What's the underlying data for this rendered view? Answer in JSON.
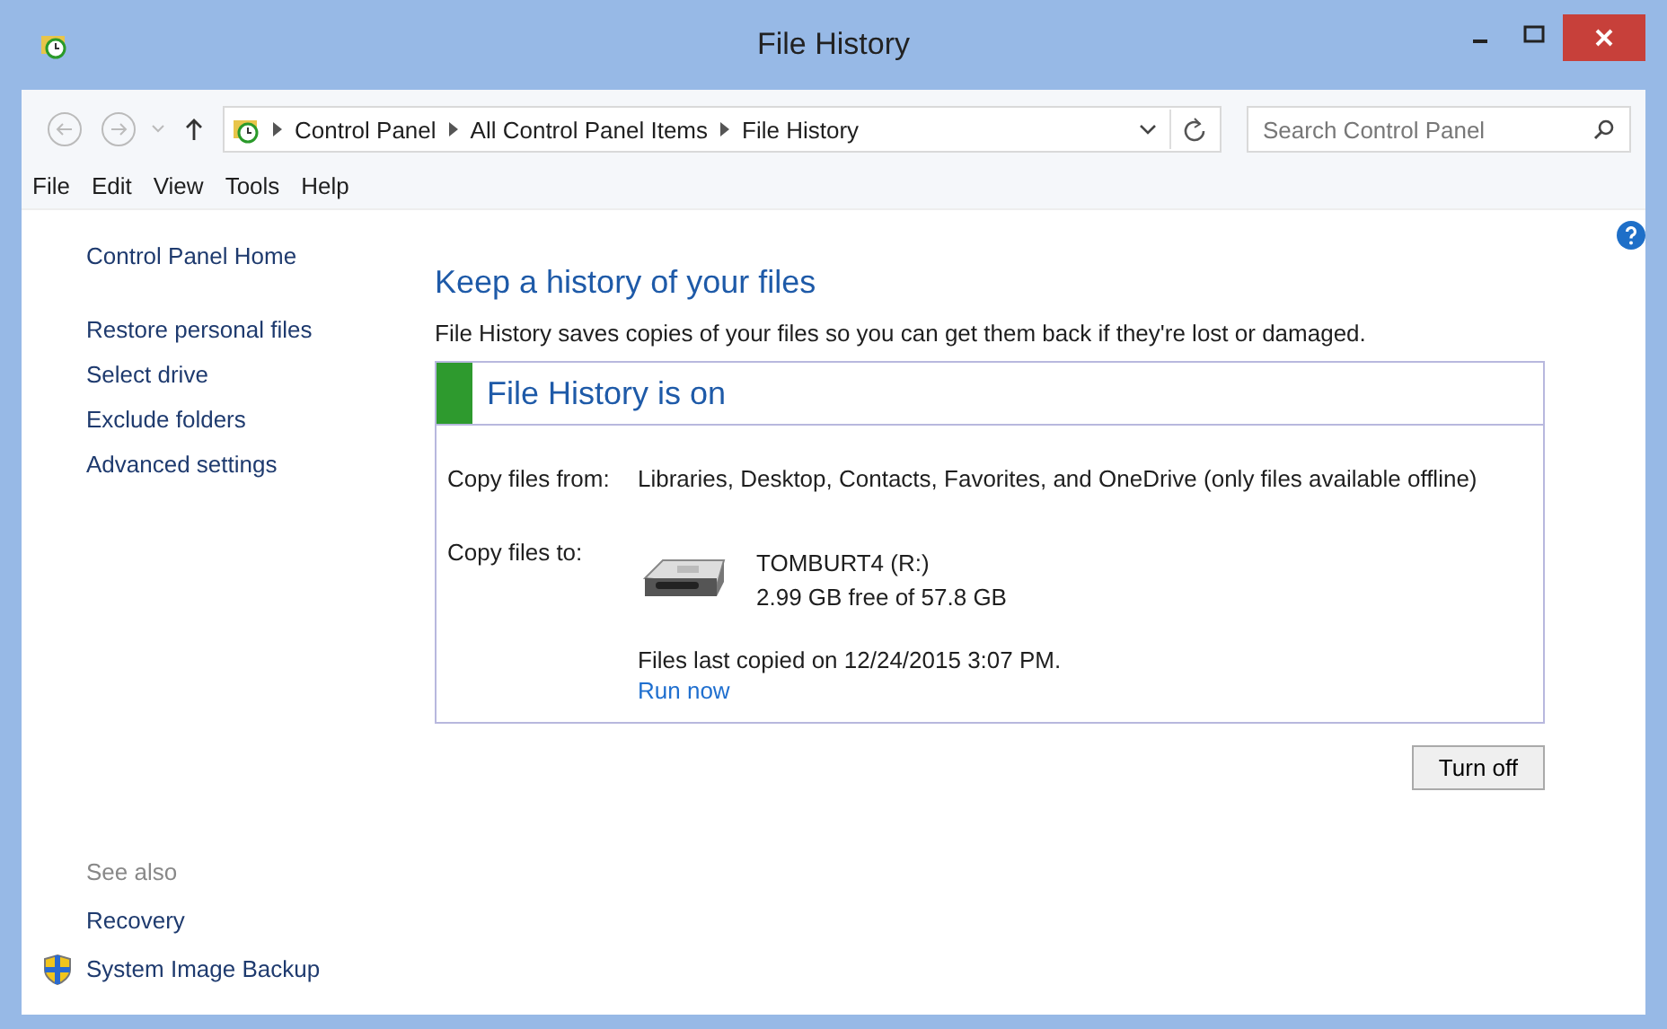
{
  "window": {
    "title": "File History"
  },
  "address_bar": {
    "breadcrumbs": [
      "Control Panel",
      "All Control Panel Items",
      "File History"
    ],
    "search": {
      "placeholder": "Search Control Panel"
    }
  },
  "menu": [
    "File",
    "Edit",
    "View",
    "Tools",
    "Help"
  ],
  "sidebar": {
    "items": [
      "Control Panel Home",
      "Restore personal files",
      "Select drive",
      "Exclude folders",
      "Advanced settings"
    ],
    "see_also": {
      "heading": "See also",
      "items": [
        {
          "label": "Recovery",
          "shield": false
        },
        {
          "label": "System Image Backup",
          "shield": true
        }
      ]
    }
  },
  "main": {
    "heading": "Keep a history of your files",
    "description": "File History saves copies of your files so you can get them back if they're lost or damaged.",
    "status": {
      "title": "File History is on",
      "on": true
    },
    "copy_from": {
      "label": "Copy files from:",
      "value": "Libraries, Desktop, Contacts, Favorites, and OneDrive (only files available offline)"
    },
    "copy_to": {
      "label": "Copy files to:",
      "drive_name": "TOMBURT4 (R:)",
      "drive_space": "2.99 GB free of 57.8 GB"
    },
    "last_copied": "Files last copied on 12/24/2015 3:07 PM.",
    "run_now": "Run now",
    "turn_off_button": "Turn off"
  }
}
